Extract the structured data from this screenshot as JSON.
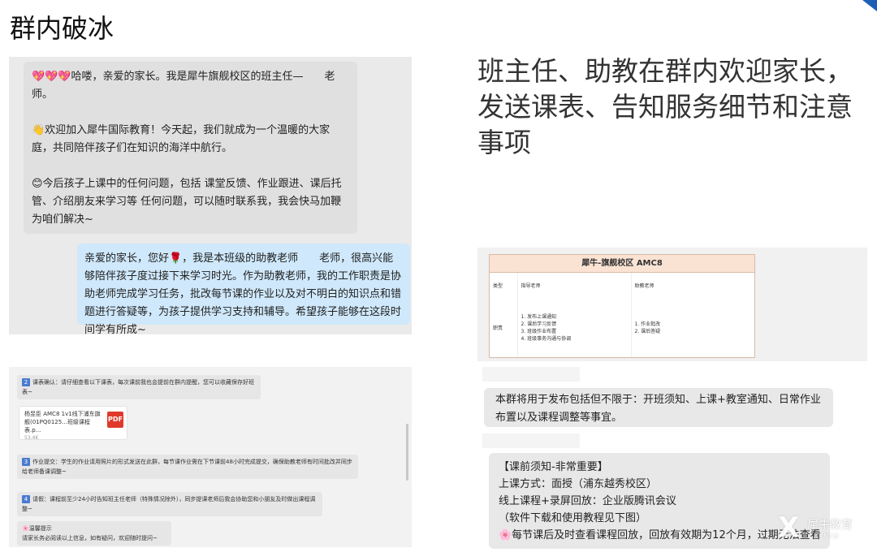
{
  "slide": {
    "title": "群内破冰",
    "headline": "班主任、助教在群内欢迎家长，发送课表、告知服务细节和注意事项"
  },
  "chat1": {
    "teacher_msg": {
      "p1": "💖💖💖哈喽，亲爱的家长。我是犀牛旗舰校区的班主任—　　老师。",
      "p2": "👋欢迎加入犀牛国际教育！今天起，我们就成为一个温暖的大家庭，共同陪伴孩子们在知识的海洋中航行。",
      "p3": "😊今后孩子上课中的任何问题，包括 课堂反馈、作业跟进、课后托管、介绍朋友来学习等 任何问题，可以随时联系我，我会快马加鞭为咱们解决~"
    },
    "assistant_msg": "亲爱的家长，您好🌹，我是本班级的助教老师　　老师，很高兴能够陪伴孩子度过接下来学习时光。作为助教老师，我的工作职责是协助老师完成学习任务，批改每节课的作业以及对不明白的知识点和错题进行答疑等，为孩子提供学习支持和辅导。希望孩子能够在这段时间学有所成~"
  },
  "chat2": {
    "row1": "课表确认：请仔细查看以下课表，每次课前我也会提前在群内提醒，您可以收藏保存好班表~",
    "row1_num": "2",
    "file_name": "杨昱臣 AMC8 1v1线下浦东旗舰(01PQ0125...班级课程表.p...",
    "file_size": "53.4K",
    "file_icon": "PDF",
    "row3": "作业提交：学生的作业请用照片的形式发送在此群，每节课作业需在下节课前48小时完成提交，确保助教老师有时间批改并同步给老师备课调整~",
    "row3_num": "3",
    "row4": "请假：课程前至少24小时告知班主任老师（特殊情况除外），同步提课老师后我会协助您和小朋友及时做出课程调整~",
    "row4_num": "4",
    "row5_title": "🌸温馨提示",
    "row5_body": "请家长务必阅读以上信息，如有疑问，欢迎随时提问~"
  },
  "sheet": {
    "title": "犀牛-旗舰校区 AMC8",
    "headers": [
      "类型",
      "指导老师",
      "助教老师"
    ],
    "row_label": "职责",
    "teacher_duties": [
      "1. 发布上课通知",
      "2. 课后学习反馈",
      "3. 班级作业布置",
      "4. 班级事务沟通与协调"
    ],
    "assistant_duties": [
      "1. 作业批改",
      "2. 课后答疑"
    ]
  },
  "notice1": "本群将用于发布包括但不限于：开班须知、上课+教室通知、日常作业布置以及课程调整等事宜。",
  "notice2": {
    "l1": "【课前须知-非常重要】",
    "l2": "上课方式：面授（浦东越秀校区）",
    "l3": "线上课程+录屏回放：企业版腾讯会议",
    "l4": "（软件下载和使用教程见下图）",
    "l5": "🌸每节课后及时查看课程回放，回放有效期为12个月，过期无法查看~"
  },
  "watermark": {
    "mark": "X",
    "text": "犀牛教育",
    "sub": "X-NIU"
  },
  "colors": {
    "accent": "#1d5fb7",
    "bubble_blue": "#cfe8fb",
    "pdf_red": "#e0392b",
    "sheet_header": "#fbe3d4"
  }
}
